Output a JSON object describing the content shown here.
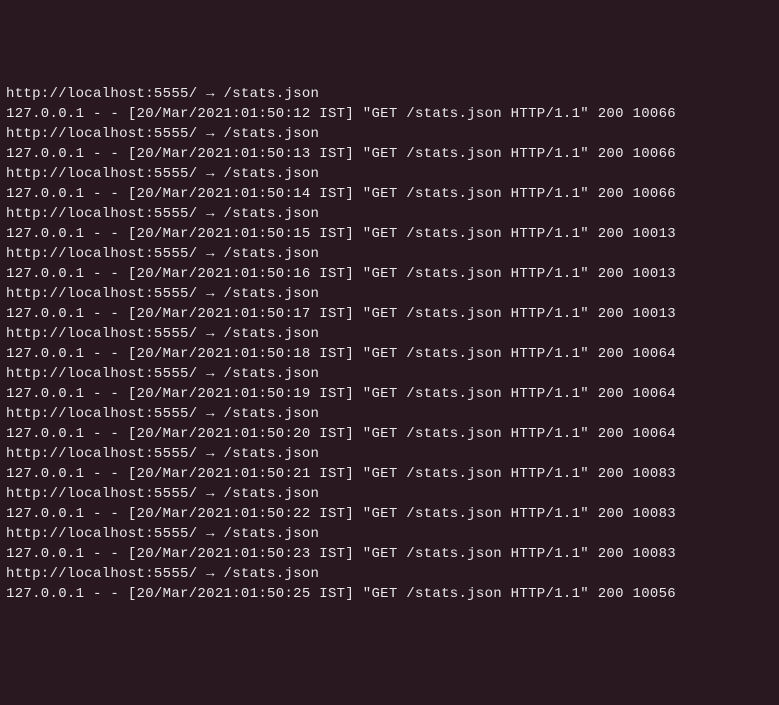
{
  "terminal": {
    "redirect_url": "http://localhost:5555/ → /stats.json",
    "client_ip": "127.0.0.1",
    "method": "GET",
    "path": "/stats.json",
    "protocol": "HTTP/1.1",
    "status": "200",
    "entries": [
      {
        "redirect": "http://localhost:5555/ → /stats.json",
        "log": "127.0.0.1 - - [20/Mar/2021:01:50:12 IST] \"GET /stats.json HTTP/1.1\" 200 10066"
      },
      {
        "redirect": "http://localhost:5555/ → /stats.json",
        "log": "127.0.0.1 - - [20/Mar/2021:01:50:13 IST] \"GET /stats.json HTTP/1.1\" 200 10066"
      },
      {
        "redirect": "http://localhost:5555/ → /stats.json",
        "log": "127.0.0.1 - - [20/Mar/2021:01:50:14 IST] \"GET /stats.json HTTP/1.1\" 200 10066"
      },
      {
        "redirect": "http://localhost:5555/ → /stats.json",
        "log": "127.0.0.1 - - [20/Mar/2021:01:50:15 IST] \"GET /stats.json HTTP/1.1\" 200 10013"
      },
      {
        "redirect": "http://localhost:5555/ → /stats.json",
        "log": "127.0.0.1 - - [20/Mar/2021:01:50:16 IST] \"GET /stats.json HTTP/1.1\" 200 10013"
      },
      {
        "redirect": "http://localhost:5555/ → /stats.json",
        "log": "127.0.0.1 - - [20/Mar/2021:01:50:17 IST] \"GET /stats.json HTTP/1.1\" 200 10013"
      },
      {
        "redirect": "http://localhost:5555/ → /stats.json",
        "log": "127.0.0.1 - - [20/Mar/2021:01:50:18 IST] \"GET /stats.json HTTP/1.1\" 200 10064"
      },
      {
        "redirect": "http://localhost:5555/ → /stats.json",
        "log": "127.0.0.1 - - [20/Mar/2021:01:50:19 IST] \"GET /stats.json HTTP/1.1\" 200 10064"
      },
      {
        "redirect": "http://localhost:5555/ → /stats.json",
        "log": "127.0.0.1 - - [20/Mar/2021:01:50:20 IST] \"GET /stats.json HTTP/1.1\" 200 10064"
      },
      {
        "redirect": "http://localhost:5555/ → /stats.json",
        "log": "127.0.0.1 - - [20/Mar/2021:01:50:21 IST] \"GET /stats.json HTTP/1.1\" 200 10083"
      },
      {
        "redirect": "http://localhost:5555/ → /stats.json",
        "log": "127.0.0.1 - - [20/Mar/2021:01:50:22 IST] \"GET /stats.json HTTP/1.1\" 200 10083"
      },
      {
        "redirect": "http://localhost:5555/ → /stats.json",
        "log": "127.0.0.1 - - [20/Mar/2021:01:50:23 IST] \"GET /stats.json HTTP/1.1\" 200 10083"
      },
      {
        "redirect": "http://localhost:5555/ → /stats.json",
        "log": "127.0.0.1 - - [20/Mar/2021:01:50:25 IST] \"GET /stats.json HTTP/1.1\" 200 10056"
      }
    ]
  }
}
